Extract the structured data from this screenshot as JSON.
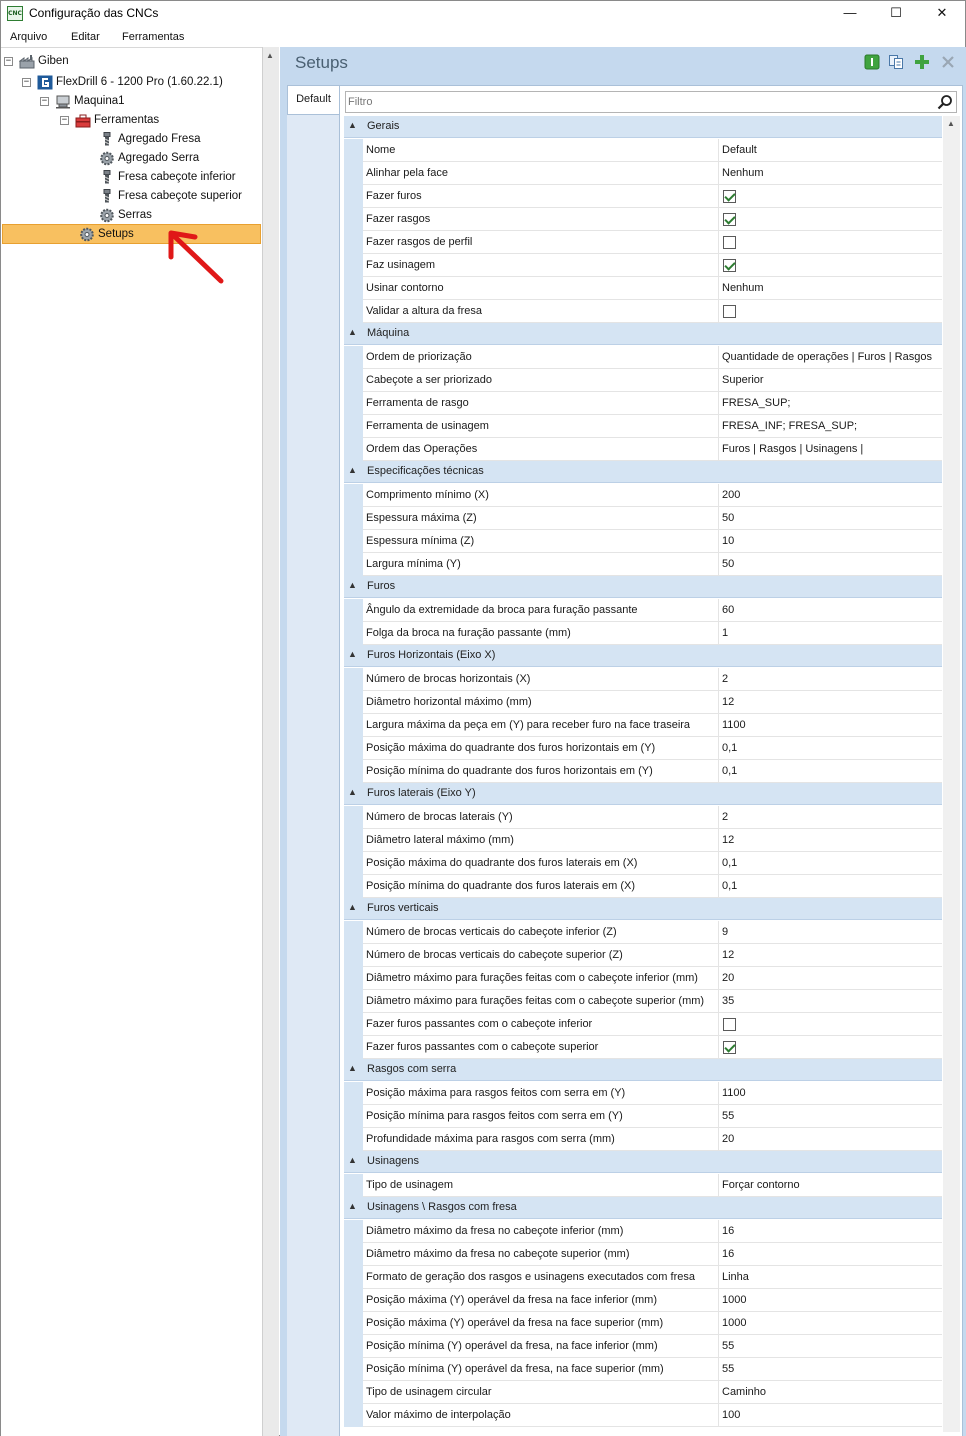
{
  "window": {
    "title": "Configuração das CNCs",
    "app_icon_text": "CNC",
    "controls": {
      "minimize": "—",
      "maximize": "☐",
      "close": "✕"
    }
  },
  "menu": [
    "Arquivo",
    "Editar",
    "Ferramentas"
  ],
  "tree": [
    {
      "label": "Giben",
      "level": 0,
      "expander": "−",
      "icon": "factory-icon"
    },
    {
      "label": "FlexDrill 6 - 1200 Pro (1.60.22.1)",
      "level": 1,
      "expander": "−",
      "icon": "giben-logo-icon"
    },
    {
      "label": "Maquina1",
      "level": 2,
      "expander": "−",
      "icon": "machine-icon"
    },
    {
      "label": "Ferramentas",
      "level": 3,
      "expander": "−",
      "icon": "toolbox-icon"
    },
    {
      "label": "Agregado Fresa",
      "level": 4,
      "icon": "drill-bit-icon"
    },
    {
      "label": "Agregado Serra",
      "level": 4,
      "icon": "saw-gear-icon"
    },
    {
      "label": "Fresa cabeçote inferior",
      "level": 4,
      "icon": "drill-bit-icon"
    },
    {
      "label": "Fresa cabeçote superior",
      "level": 4,
      "icon": "drill-bit-icon"
    },
    {
      "label": "Serras",
      "level": 4,
      "icon": "saw-gear-icon"
    },
    {
      "label": "Setups",
      "level": 3,
      "icon": "gear-icon",
      "selected": true
    }
  ],
  "panel": {
    "title": "Setups",
    "tab": "Default",
    "filter_placeholder": "Filtro",
    "toolbar": [
      "info-icon",
      "copy-icon",
      "add-icon",
      "delete-icon"
    ]
  },
  "colors": {
    "selection": "#f8c060",
    "panel_bg": "#c5d9ee",
    "category_bg": "#d5e4f3",
    "check": "#2e7d32"
  },
  "categories": [
    {
      "name": "Gerais",
      "props": [
        {
          "name": "Nome",
          "value": "Default"
        },
        {
          "name": "Alinhar pela face",
          "value": "Nenhum"
        },
        {
          "name": "Fazer furos",
          "check": true
        },
        {
          "name": "Fazer rasgos",
          "check": true
        },
        {
          "name": "Fazer rasgos de perfil",
          "check": false
        },
        {
          "name": "Faz usinagem",
          "check": true
        },
        {
          "name": "Usinar contorno",
          "value": "Nenhum"
        },
        {
          "name": "Validar a altura da fresa",
          "check": false
        }
      ]
    },
    {
      "name": "Máquina",
      "props": [
        {
          "name": "Ordem de priorização",
          "value": "Quantidade de operações | Furos | Rasgos"
        },
        {
          "name": "Cabeçote a ser priorizado",
          "value": "Superior"
        },
        {
          "name": "Ferramenta de rasgo",
          "value": "FRESA_SUP;"
        },
        {
          "name": "Ferramenta de usinagem",
          "value": "FRESA_INF; FRESA_SUP;"
        },
        {
          "name": "Ordem das Operações",
          "value": "Furos | Rasgos | Usinagens |"
        }
      ]
    },
    {
      "name": "Especificações técnicas",
      "props": [
        {
          "name": "Comprimento mínimo (X)",
          "value": "200"
        },
        {
          "name": "Espessura máxima (Z)",
          "value": "50"
        },
        {
          "name": "Espessura mínima (Z)",
          "value": "10"
        },
        {
          "name": "Largura mínima (Y)",
          "value": "50"
        }
      ]
    },
    {
      "name": "Furos",
      "props": [
        {
          "name": "Ângulo da extremidade da broca para furação passante",
          "value": "60"
        },
        {
          "name": "Folga da broca na furação passante (mm)",
          "value": "1"
        }
      ]
    },
    {
      "name": "Furos Horizontais (Eixo X)",
      "props": [
        {
          "name": "Número de brocas horizontais (X)",
          "value": "2"
        },
        {
          "name": "Diâmetro horizontal máximo (mm)",
          "value": "12"
        },
        {
          "name": "Largura máxima da peça em (Y) para receber furo na face traseira",
          "value": "1100"
        },
        {
          "name": "Posição máxima do quadrante dos furos horizontais em (Y)",
          "value": "0,1"
        },
        {
          "name": "Posição mínima do quadrante dos furos horizontais em (Y)",
          "value": "0,1"
        }
      ]
    },
    {
      "name": "Furos laterais (Eixo Y)",
      "props": [
        {
          "name": "Número de brocas laterais (Y)",
          "value": "2"
        },
        {
          "name": "Diâmetro lateral máximo (mm)",
          "value": "12"
        },
        {
          "name": "Posição máxima do quadrante dos furos laterais em (X)",
          "value": "0,1"
        },
        {
          "name": "Posição mínima do quadrante dos furos laterais em (X)",
          "value": "0,1"
        }
      ]
    },
    {
      "name": "Furos verticais",
      "props": [
        {
          "name": "Número de brocas verticais do cabeçote inferior (Z)",
          "value": "9"
        },
        {
          "name": "Número de brocas verticais do cabeçote superior (Z)",
          "value": "12"
        },
        {
          "name": "Diâmetro máximo para furações feitas com o cabeçote inferior (mm)",
          "value": "20"
        },
        {
          "name": "Diâmetro máximo para furações feitas com o cabeçote superior (mm)",
          "value": "35"
        },
        {
          "name": "Fazer furos passantes com o cabeçote inferior",
          "check": false
        },
        {
          "name": "Fazer furos passantes com o cabeçote superior",
          "check": true
        }
      ]
    },
    {
      "name": "Rasgos com serra",
      "props": [
        {
          "name": "Posição máxima para rasgos feitos com serra em (Y)",
          "value": "1100"
        },
        {
          "name": "Posição mínima para rasgos feitos com serra em (Y)",
          "value": "55"
        },
        {
          "name": "Profundidade máxima para rasgos com serra (mm)",
          "value": "20"
        }
      ]
    },
    {
      "name": "Usinagens",
      "props": [
        {
          "name": "Tipo de usinagem",
          "value": "Forçar contorno"
        }
      ]
    },
    {
      "name": "Usinagens \\ Rasgos com fresa",
      "props": [
        {
          "name": "Diâmetro máximo da fresa no cabeçote inferior (mm)",
          "value": "16"
        },
        {
          "name": "Diâmetro máximo da fresa no cabeçote superior (mm)",
          "value": "16"
        },
        {
          "name": "Formato de geração dos rasgos e usinagens executados com fresa",
          "value": "Linha"
        },
        {
          "name": "Posição máxima (Y) operável da fresa na face inferior (mm)",
          "value": "1000"
        },
        {
          "name": "Posição máxima (Y) operável da fresa na face superior (mm)",
          "value": "1000"
        },
        {
          "name": "Posição mínima (Y) operável da fresa, na face inferior (mm)",
          "value": "55"
        },
        {
          "name": "Posição mínima (Y) operável da fresa, na face superior (mm)",
          "value": "55"
        },
        {
          "name": "Tipo de usinagem circular",
          "value": "Caminho"
        },
        {
          "name": "Valor máximo de interpolação",
          "value": "100"
        }
      ]
    }
  ]
}
